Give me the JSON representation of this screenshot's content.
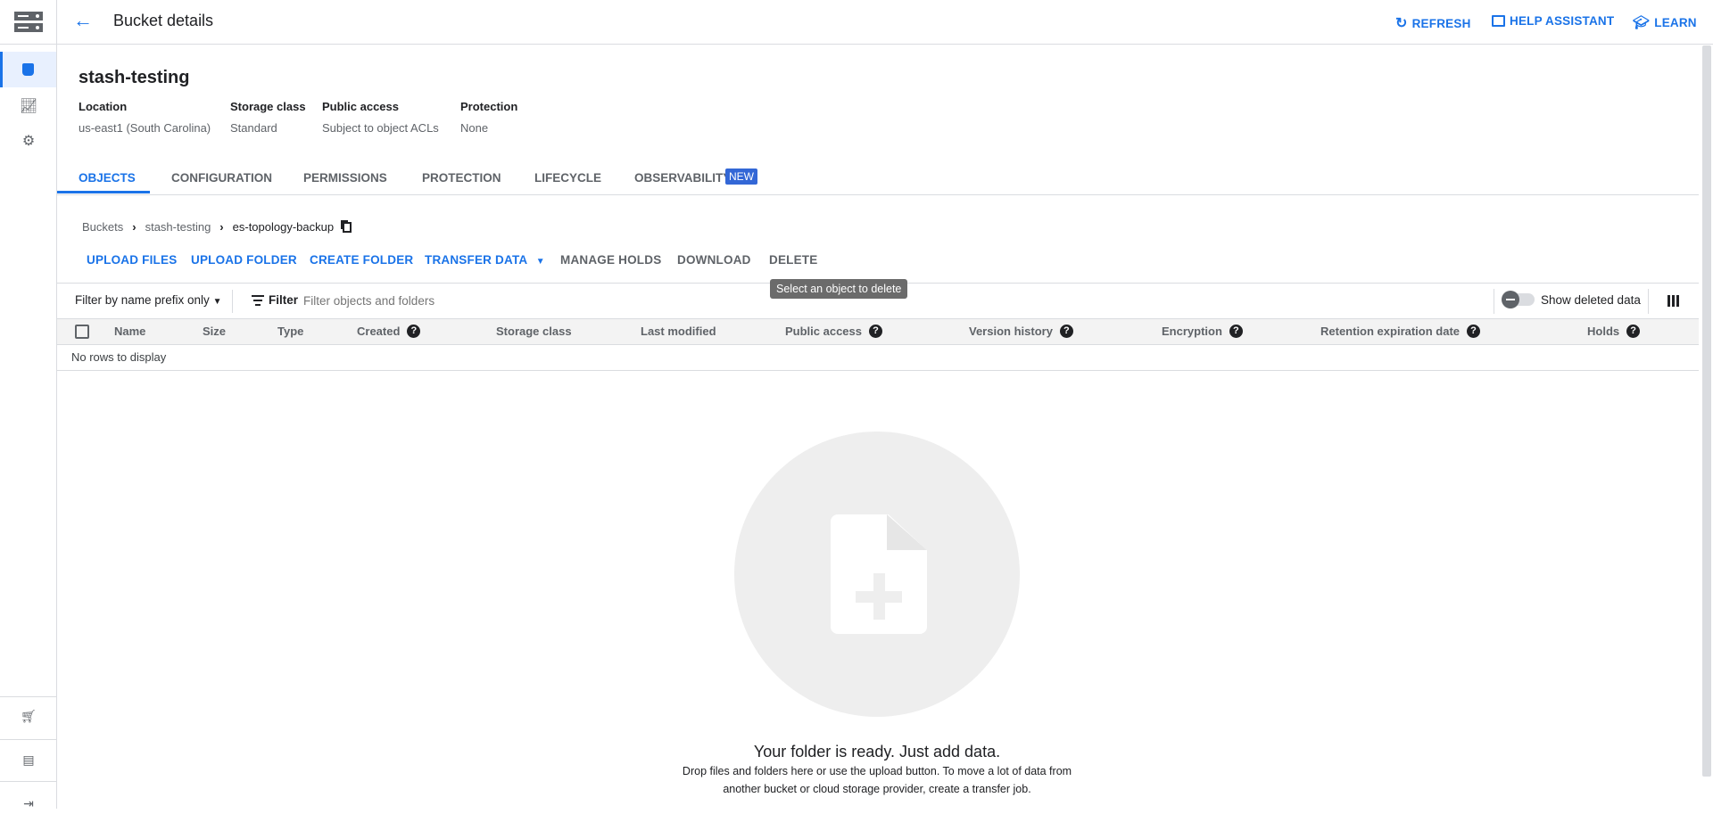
{
  "header": {
    "title": "Bucket details",
    "refresh": "REFRESH",
    "help_assistant": "HELP ASSISTANT",
    "learn": "LEARN"
  },
  "sidebar": {
    "items": [
      {
        "icon": "bucket-icon",
        "active": true
      },
      {
        "icon": "chart-icon"
      },
      {
        "icon": "gear-icon"
      },
      {
        "icon": "cart-icon"
      },
      {
        "icon": "release-notes-icon"
      },
      {
        "icon": "expand-icon"
      }
    ]
  },
  "bucket": {
    "name": "stash-testing",
    "info": [
      {
        "label": "Location",
        "value": "us-east1 (South Carolina)"
      },
      {
        "label": "Storage class",
        "value": "Standard"
      },
      {
        "label": "Public access",
        "value": "Subject to object ACLs"
      },
      {
        "label": "Protection",
        "value": "None"
      }
    ]
  },
  "tabs": [
    {
      "label": "OBJECTS",
      "active": true
    },
    {
      "label": "CONFIGURATION"
    },
    {
      "label": "PERMISSIONS"
    },
    {
      "label": "PROTECTION"
    },
    {
      "label": "LIFECYCLE"
    },
    {
      "label": "OBSERVABILITY",
      "badge": "NEW"
    }
  ],
  "breadcrumb": [
    "Buckets",
    "stash-testing",
    "es-topology-backup"
  ],
  "actions": {
    "upload_files": "UPLOAD FILES",
    "upload_folder": "UPLOAD FOLDER",
    "create_folder": "CREATE FOLDER",
    "transfer_data": "TRANSFER DATA",
    "manage_holds": "MANAGE HOLDS",
    "download": "DOWNLOAD",
    "delete": "DELETE",
    "delete_tooltip": "Select an object to delete"
  },
  "filter": {
    "mode": "Filter by name prefix only",
    "label": "Filter",
    "placeholder": "Filter objects and folders",
    "show_deleted": "Show deleted data",
    "show_deleted_on": false
  },
  "table": {
    "columns": [
      "Name",
      "Size",
      "Type",
      "Created",
      "Storage class",
      "Last modified",
      "Public access",
      "Version history",
      "Encryption",
      "Retention expiration date",
      "Holds"
    ],
    "empty": "No rows to display"
  },
  "empty_state": {
    "title": "Your folder is ready. Just add data.",
    "line1": "Drop files and folders here or use the upload button. To move a lot of data from",
    "line2": "another bucket or cloud storage provider, create a transfer job."
  },
  "colors": {
    "accent": "#1a73e8",
    "badge": "#3367d6"
  }
}
